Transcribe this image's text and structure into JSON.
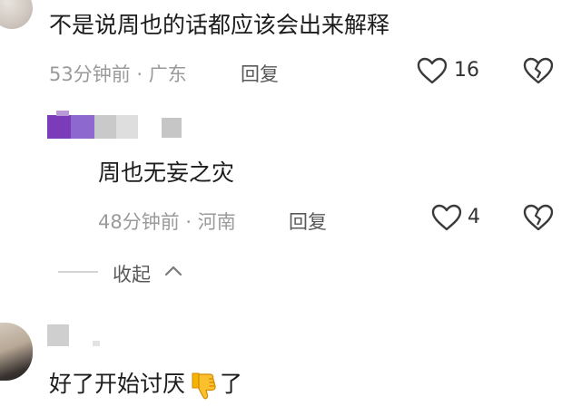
{
  "comments": [
    {
      "text": "不是说周也的话都应该会出来解释",
      "time_location": "53分钟前 · 广东",
      "reply_label": "回复",
      "like_count": "16"
    },
    {
      "text": "周也无妄之灾",
      "time_location": "48分钟前 · 河南",
      "reply_label": "回复",
      "like_count": "4",
      "username_color": "#6a2fa8"
    },
    {
      "text": "好了开始讨厌",
      "suffix": "了",
      "emoji": "thumbs-down-icon"
    }
  ],
  "collapse": {
    "label": "收起"
  },
  "colors": {
    "like_outline": "#3a3a3a",
    "meta_gray": "#9a9a9a"
  }
}
